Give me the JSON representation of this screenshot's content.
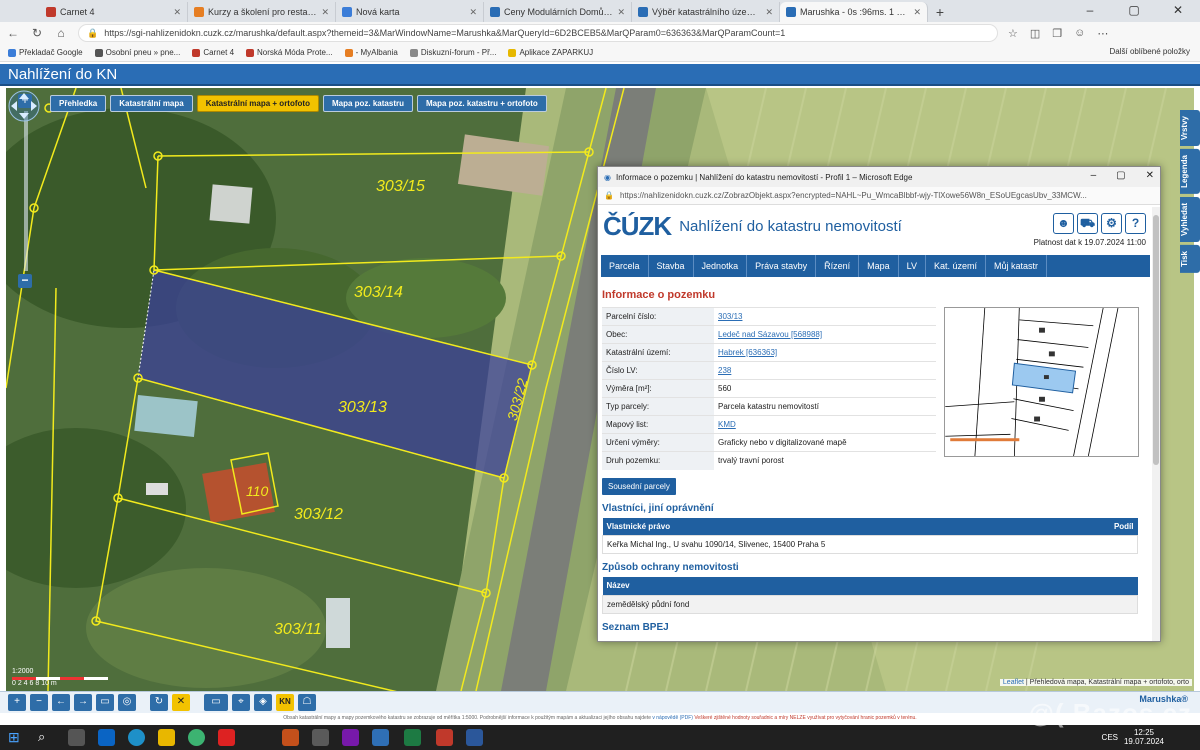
{
  "browser": {
    "tabs": [
      {
        "label": "Carnet 4",
        "color": "#c0392b"
      },
      {
        "label": "Kurzy a školení pro restaurace a",
        "color": "#e67e22"
      },
      {
        "label": "Nová karta",
        "color": "#3b7dd8"
      },
      {
        "label": "Ceny Modulárních Domů - Lifest",
        "color": "#2a6db5"
      },
      {
        "label": "Výběr katastrálního území | Nah",
        "color": "#2a6db5"
      },
      {
        "label": "Marushka - 0s :96ms. 1 prvků.",
        "color": "#2a6db5"
      }
    ],
    "url": "https://sgi-nahlizenidokn.cuzk.cz/marushka/default.aspx?themeid=3&MarWindowName=Marushka&MarQueryId=6D2BCEB5&MarQParam0=636363&MarQParamCount=1",
    "bookmarks": [
      {
        "label": "Překladač Google",
        "color": "#3b7dd8"
      },
      {
        "label": "Osobní pneu » pne...",
        "color": "#555555"
      },
      {
        "label": "Carnet 4",
        "color": "#c0392b"
      },
      {
        "label": "Norská Móda Prote...",
        "color": "#c0392b"
      },
      {
        "label": "- MyAlbania",
        "color": "#e67e22"
      },
      {
        "label": "Diskuzní-forum - Př...",
        "color": "#888888"
      },
      {
        "label": "Aplikace ZAPARKUJ",
        "color": "#e6b800"
      }
    ],
    "bookmarks_other": "Další oblíbené položky"
  },
  "app": {
    "title": "Nahlížení do KN",
    "layers": [
      "Přehledka",
      "Katastrální mapa",
      "Katastrální mapa + ortofoto",
      "Mapa poz. katastru",
      "Mapa poz. katastru + ortofoto"
    ],
    "active_layer": "Katastrální mapa + ortofoto",
    "side_tabs": [
      "Vrstvy",
      "Legenda",
      "Vyhledat",
      "Tisk"
    ],
    "parcels": [
      "303/15",
      "303/14",
      "303/13",
      "303/12",
      "303/11",
      "303/22",
      "110"
    ],
    "scale_label": "1:2000",
    "scale_ticks": "0   2   4   6   8   10 m",
    "attribution": {
      "leaflet": "Leaflet",
      "text": "| Přehledová mapa, Katastrální mapa + ortofoto, orto"
    },
    "brand": "Marushka®",
    "footnote_1": "Obsah katastrální mapy a mapy pozemkového katastru se zobrazuje od měřítka 1:5000. Podrobnější informace k použitým mapám a aktualizaci jejího obsahu najdete",
    "footnote_link": "v nápovědě (PDF)",
    "footnote_2": "Veškeré zjištěné hodnoty souřadnic a míry NELZE využívat pro vytyčování hranic pozemků v terénu."
  },
  "popup": {
    "window_title": "Informace o pozemku | Nahlížení do katastru nemovitostí - Profil 1 – Microsoft Edge",
    "url": "https://nahlizenidokn.cuzk.cz/ZobrazObjekt.aspx?encrypted=NAHL~Pu_WmcaBlbbf-wjy-TlXowe56W8n_ESoUEgcasUbv_33MCW...",
    "logo": "ČÚZK",
    "site_title": "Nahlížení do katastru nemovitostí",
    "validity": "Platnost dat k 19.07.2024 11:00",
    "menu": [
      "Parcela",
      "Stavba",
      "Jednotka",
      "Práva stavby",
      "Řízení",
      "Mapa",
      "LV",
      "Kat. území",
      "Můj katastr"
    ],
    "heading": "Informace o pozemku",
    "info": [
      {
        "k": "Parcelní číslo:",
        "v": "303/13",
        "link": true
      },
      {
        "k": "Obec:",
        "v": "Ledeč nad Sázavou [568988]",
        "link": true
      },
      {
        "k": "Katastrální území:",
        "v": "Habrek [636363]",
        "link": true
      },
      {
        "k": "Číslo LV:",
        "v": "238",
        "link": true
      },
      {
        "k": "Výměra [m²]:",
        "v": "560",
        "link": false
      },
      {
        "k": "Typ parcely:",
        "v": "Parcela katastru nemovitostí",
        "link": false
      },
      {
        "k": "Mapový list:",
        "v": "KMD",
        "link": true
      },
      {
        "k": "Určení výměry:",
        "v": "Graficky nebo v digitalizované mapě",
        "link": false
      },
      {
        "k": "Druh pozemku:",
        "v": "trvalý travní porost",
        "link": false
      }
    ],
    "neighbors_btn": "Sousední parcely",
    "owners_heading": "Vlastníci, jiní oprávnění",
    "owners_col1": "Vlastnické právo",
    "owners_col2": "Podíl",
    "owner": "Keřka Michal Ing., U svahu 1090/14, Slivenec, 15400 Praha 5",
    "protection_heading": "Způsob ochrany nemovitosti",
    "protection_col": "Název",
    "protection_value": "zemědělský půdní fond",
    "bpej_heading": "Seznam BPEJ"
  },
  "taskbar": {
    "time": "12:25",
    "date": "19.07.2024",
    "lang": "CES",
    "watermark": "@( Bazos.cz"
  }
}
